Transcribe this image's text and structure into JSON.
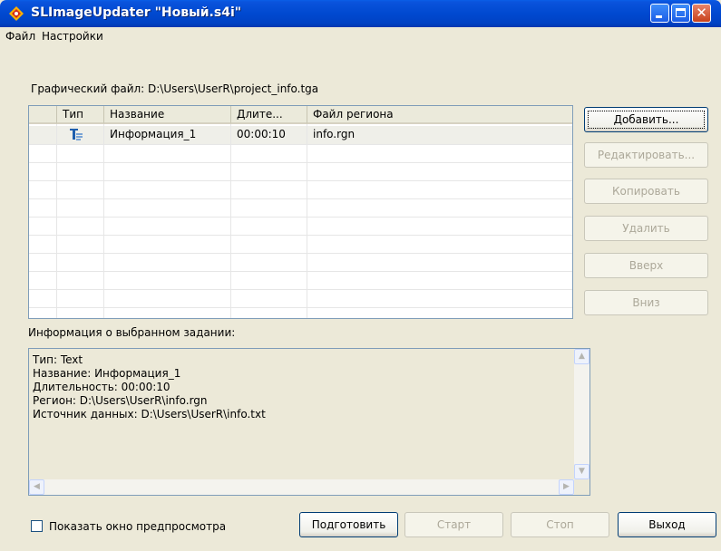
{
  "window": {
    "title": "SLImageUpdater \"Новый.s4i\""
  },
  "menu": {
    "items": [
      {
        "label": "Файл"
      },
      {
        "label": "Настройки"
      }
    ]
  },
  "graphic_file": {
    "text": "Графический файл: D:\\Users\\UserR\\project_info.tga"
  },
  "table": {
    "columns": [
      "",
      "Тип",
      "Название",
      "Длите...",
      "Файл региона"
    ],
    "rows": [
      {
        "type_icon": "text-task-icon",
        "name": "Информация_1",
        "duration": "00:00:10",
        "region_file": "info.rgn",
        "selected": true
      }
    ]
  },
  "buttons": {
    "add": "Добавить...",
    "edit": "Редактировать...",
    "copy": "Копировать",
    "delete": "Удалить",
    "up": "Вверх",
    "down": "Вниз",
    "prepare": "Подготовить",
    "start": "Старт",
    "stop": "Стоп",
    "exit": "Выход"
  },
  "info": {
    "label": "Информация о выбранном задании:",
    "lines": [
      "Тип: Text",
      "Название: Информация_1",
      "Длительность: 00:00:10",
      "Регион: D:\\Users\\UserR\\info.rgn",
      "Источник данных: D:\\Users\\UserR\\info.txt"
    ]
  },
  "preview": {
    "label": "Показать окно предпросмотра",
    "checked": false
  }
}
